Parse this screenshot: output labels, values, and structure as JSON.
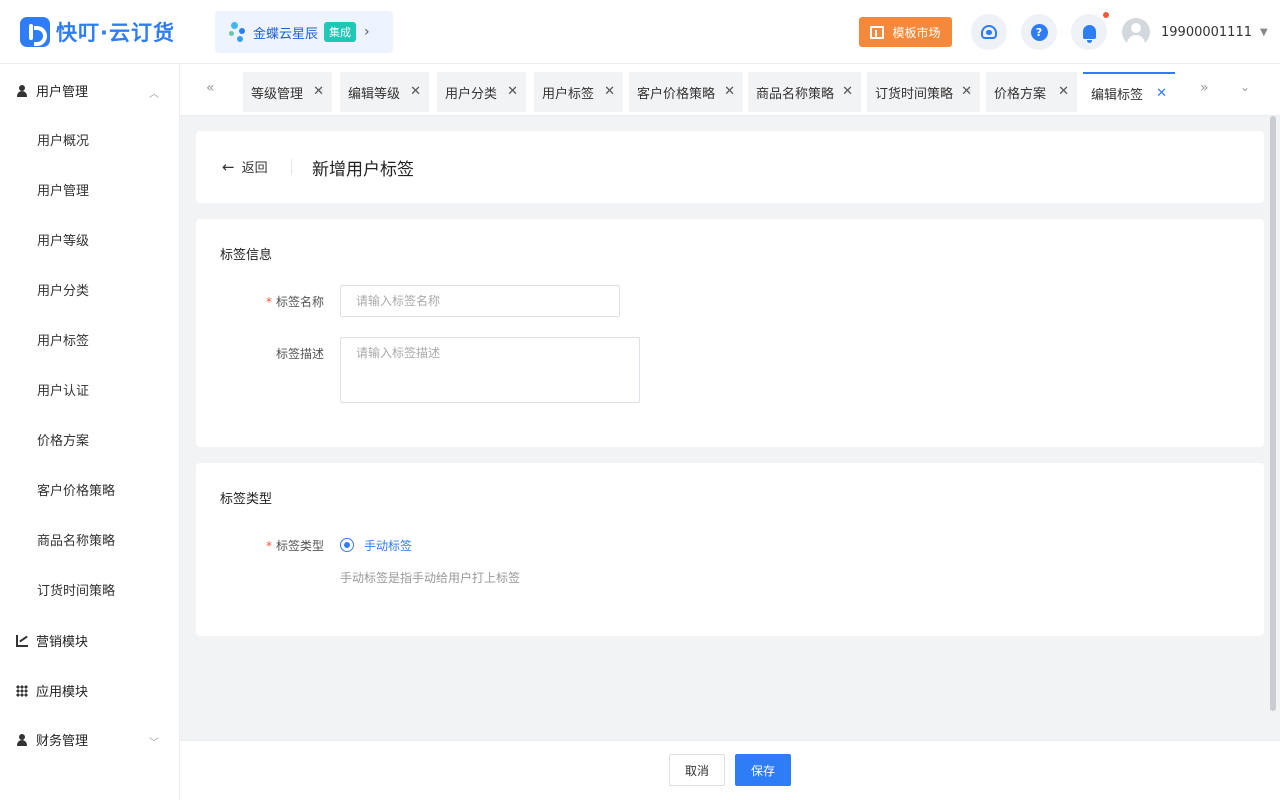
{
  "header": {
    "logo_text": "快叮·云订货",
    "kingdee_text": "金蝶云星辰",
    "kingdee_badge": "集成",
    "market_label": "模板市场",
    "help_glyph": "?",
    "username": "19900001111",
    "icons": [
      "logo-icon",
      "kingdee-icon",
      "template-icon",
      "customer-service-icon",
      "help-icon",
      "bell-icon",
      "avatar",
      "chevron-down-icon"
    ]
  },
  "sidebar": {
    "groups": [
      {
        "label": "用户管理",
        "icon": "user-icon",
        "expanded": true
      },
      {
        "label": "营销模块",
        "icon": "chart-icon"
      },
      {
        "label": "应用模块",
        "icon": "grid-icon"
      },
      {
        "label": "财务管理",
        "icon": "finance-icon"
      }
    ],
    "items": [
      "用户概况",
      "用户管理",
      "用户等级",
      "用户分类",
      "用户标签",
      "用户认证",
      "价格方案",
      "客户价格策略",
      "商品名称策略",
      "订货时间策略"
    ]
  },
  "tabs": [
    {
      "label": "等级管理"
    },
    {
      "label": "编辑等级"
    },
    {
      "label": "用户分类"
    },
    {
      "label": "用户标签"
    },
    {
      "label": "客户价格策略"
    },
    {
      "label": "商品名称策略"
    },
    {
      "label": "订货时间策略"
    },
    {
      "label": "价格方案"
    },
    {
      "label": "编辑标签",
      "active": true
    }
  ],
  "page": {
    "back_label": "返回",
    "title": "新增用户标签"
  },
  "tag_info": {
    "section_title": "标签信息",
    "name_label": "标签名称",
    "name_placeholder": "请输入标签名称",
    "desc_label": "标签描述",
    "desc_placeholder": "请输入标签描述"
  },
  "tag_type": {
    "section_title": "标签类型",
    "type_label": "标签类型",
    "option_label": "手动标签",
    "hint": "手动标签是指手动给用户打上标签"
  },
  "footer": {
    "cancel_label": "取消",
    "save_label": "保存"
  },
  "colors": {
    "primary": "#2f7df6",
    "market": "#f5883a",
    "required": "#f5583a",
    "badge": "#1fc8b6"
  }
}
